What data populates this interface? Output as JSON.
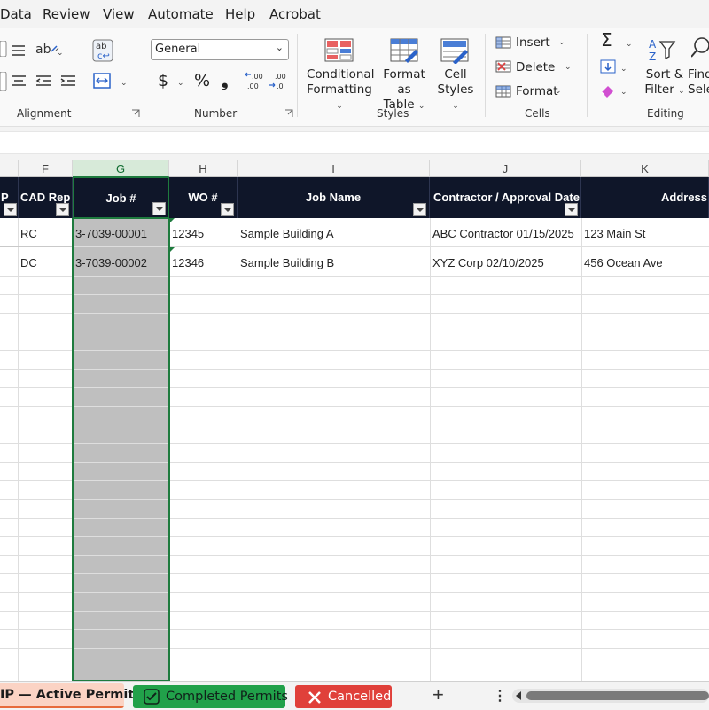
{
  "menu": [
    "Data",
    "Review",
    "View",
    "Automate",
    "Help",
    "Acrobat"
  ],
  "ribbon": {
    "alignment_label": "Alignment",
    "number_label": "Number",
    "number_format": "General",
    "styles_label": "Styles",
    "conditional_formatting": [
      "Conditional",
      "Formatting"
    ],
    "format_as_table": [
      "Format as",
      "Table"
    ],
    "cell_styles": [
      "Cell",
      "Styles"
    ],
    "cells_label": "Cells",
    "insert": "Insert",
    "delete": "Delete",
    "format": "Format",
    "editing_label": "Editing",
    "sort_filter": [
      "Sort &",
      "Filter"
    ],
    "find_select": [
      "Find",
      "Sele"
    ],
    "currency_symbol": "$",
    "percent_symbol": "%",
    "comma_symbol": "❟",
    "sum_symbol": "Σ",
    "increase_decimal": [
      ".00",
      ".00"
    ],
    "decrease_decimal": [
      ".00",
      ".0"
    ]
  },
  "columns": [
    "F",
    "G",
    "H",
    "I",
    "J",
    "K"
  ],
  "table_headers": {
    "partial": "P",
    "cad_rep": "CAD Rep",
    "job": "Job #",
    "wo": "WO #",
    "job_name": "Job Name",
    "contractor": "Contractor / Approval Date",
    "address": "Address"
  },
  "rows": [
    {
      "cad_rep": "RC",
      "job": "3-7039-00001",
      "wo": "12345",
      "job_name": "Sample Building A",
      "contractor": "ABC Contractor 01/15/2025",
      "address": "123 Main St"
    },
    {
      "cad_rep": "DC",
      "job": "3-7039-00002",
      "wo": "12346",
      "job_name": "Sample Building B",
      "contractor": "XYZ Corp 02/10/2025",
      "address": "456 Ocean Ave"
    }
  ],
  "sheet_tabs": {
    "active": "IP — Active Permits",
    "completed": "Completed Permits",
    "cancelled": "Cancelled",
    "add": "+",
    "more": "⋮"
  },
  "colors": {
    "header_bg": "#0f1629",
    "selected_col": "#1e7b3e",
    "completed_tab": "#21a14a",
    "cancelled_tab": "#e0403a",
    "active_tab": "#fbd3c4"
  }
}
